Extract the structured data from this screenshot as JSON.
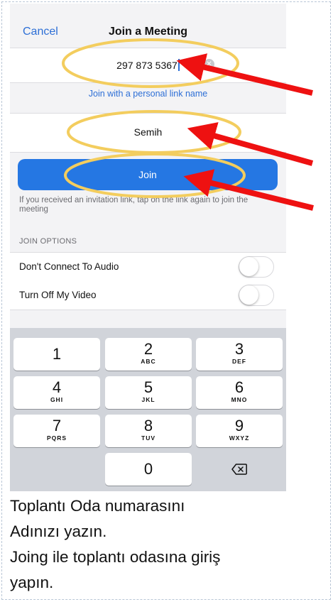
{
  "nav": {
    "cancel_label": "Cancel",
    "title": "Join a Meeting"
  },
  "meeting_id": {
    "value": "297 873 5367"
  },
  "personal_link_label": "Join with a personal link name",
  "name_field": {
    "value": "Semih"
  },
  "join_button_label": "Join",
  "hint_text": "If you received an invitation link, tap on the link again to join the meeting",
  "join_options": {
    "header": "JOIN OPTIONS",
    "items": [
      {
        "label": "Don't Connect To Audio",
        "on": false
      },
      {
        "label": "Turn Off My Video",
        "on": false
      }
    ]
  },
  "keypad": [
    {
      "digit": "1",
      "letters": ""
    },
    {
      "digit": "2",
      "letters": "ABC"
    },
    {
      "digit": "3",
      "letters": "DEF"
    },
    {
      "digit": "4",
      "letters": "GHI"
    },
    {
      "digit": "5",
      "letters": "JKL"
    },
    {
      "digit": "6",
      "letters": "MNO"
    },
    {
      "digit": "7",
      "letters": "PQRS"
    },
    {
      "digit": "8",
      "letters": "TUV"
    },
    {
      "digit": "9",
      "letters": "WXYZ"
    },
    {
      "digit": "0",
      "letters": ""
    }
  ],
  "instructions": [
    "Toplantı Oda numarasını",
    "Adınızı yazın.",
    "Joing ile toplantı odasına giriş",
    "yapın."
  ],
  "colors": {
    "accent": "#2577e3",
    "link": "#2d6fd6",
    "highlight_ellipse": "#f3cd5e",
    "arrow": "#ee1111"
  }
}
